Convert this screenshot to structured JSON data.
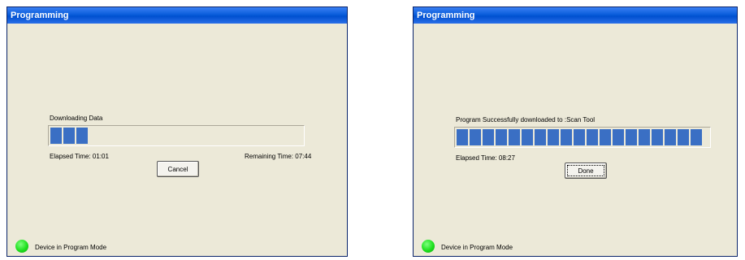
{
  "left_window": {
    "title": "Programming",
    "status": "Downloading Data",
    "progress_fraction": 0.15,
    "elapsed": "Elapsed Time: 01:01",
    "remaining": "Remaining Time: 07:44",
    "button_label": "Cancel",
    "device_status": "Device in Program Mode",
    "led_color": "#1ee01e"
  },
  "right_window": {
    "title": "Programming",
    "status": "Program Successfully downloaded to :Scan Tool",
    "progress_fraction": 1.0,
    "elapsed": "Elapsed Time: 08:27",
    "button_label": "Done",
    "device_status": "Device in Program Mode",
    "led_color": "#1ee01e"
  },
  "colors": {
    "titlebar": "#0a5ddb",
    "progress_fill": "#3a6fc4",
    "window_bg": "#ece9d8"
  }
}
